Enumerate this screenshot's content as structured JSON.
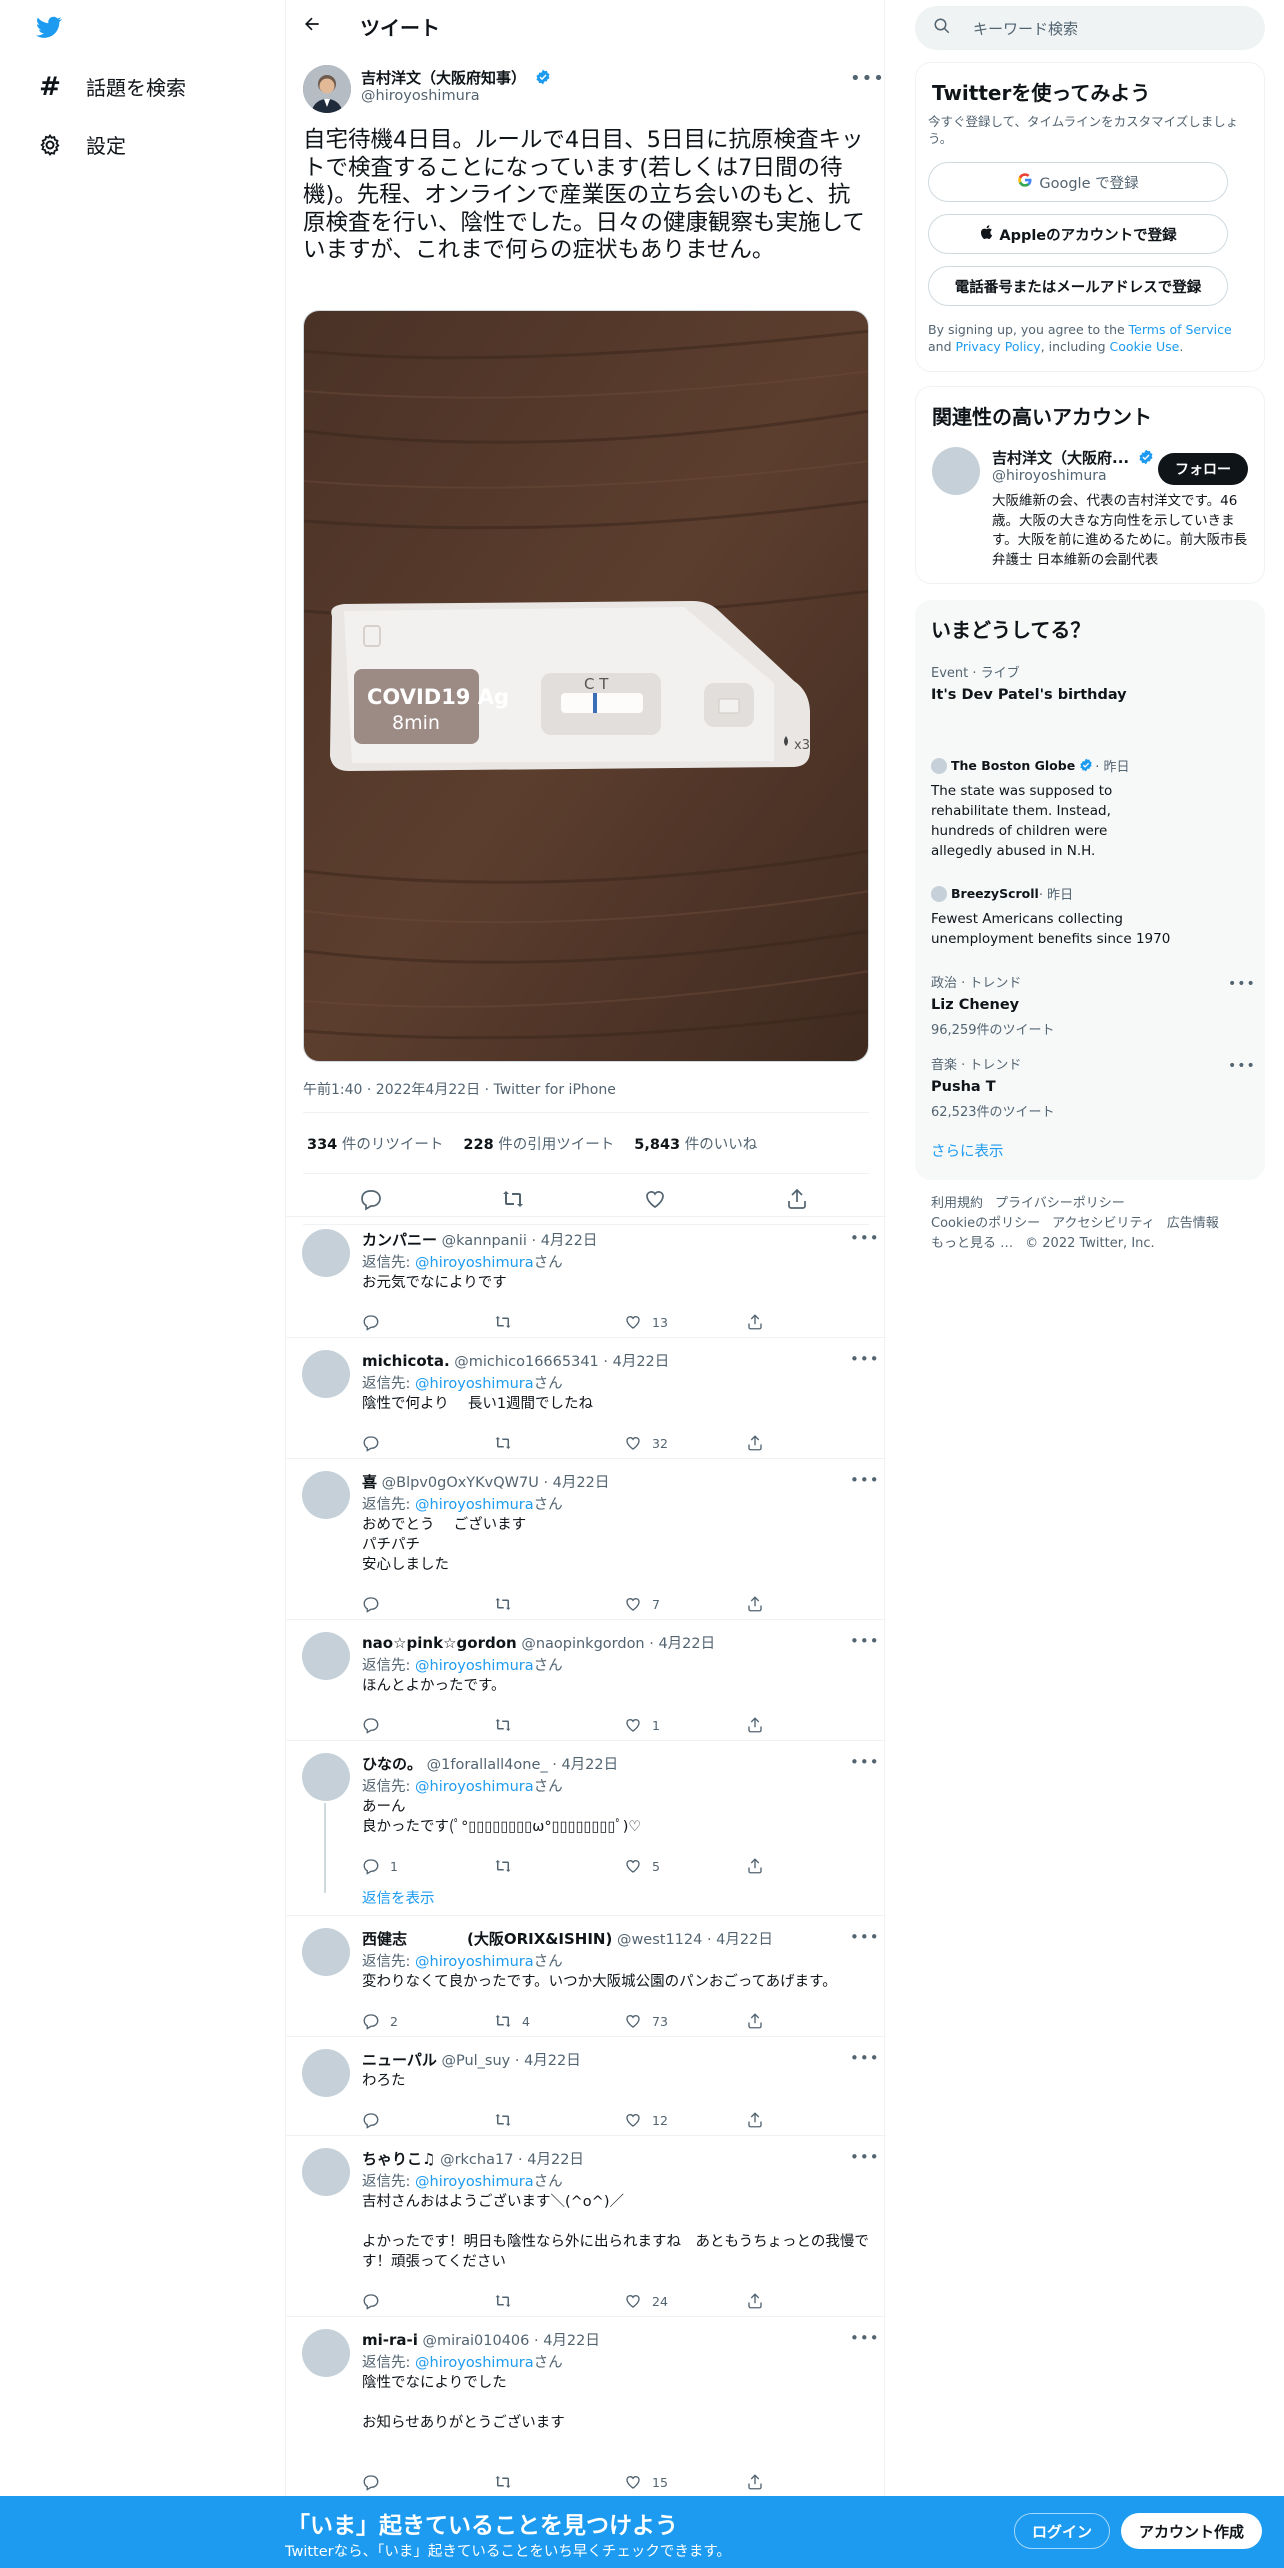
{
  "nav": {
    "logo": "twitter-bird",
    "items": [
      {
        "icon": "hashtag-icon",
        "label": "話題を検索"
      },
      {
        "icon": "gear-icon",
        "label": "設定"
      }
    ]
  },
  "header": {
    "title": "ツイート"
  },
  "tweet": {
    "author_name": "吉村洋文（大阪府知事）",
    "handle": "@hiroyoshimura",
    "text": "自宅待機4日目。ルールで4日目、5日目に抗原検査キットで検査することになっています(若しくは7日間の待機)。先程、オンラインで産業医の立ち会いのもと、抗原検査を行い、陰性でした。日々の健康観察も実施していますが、これまで何らの症状もありません。",
    "image": {
      "kit_brand": "COVID19 Ag",
      "kit_time": "8min",
      "ct": "C T",
      "drops": "x3"
    },
    "meta": "午前1:40 · 2022年4月22日 · Twitter for iPhone",
    "retweets": "334",
    "retweets_label": "件のリツイート",
    "quotes": "228",
    "quotes_label": "件の引用ツイート",
    "likes": "5,843",
    "likes_label": "件のいいね"
  },
  "replies": [
    {
      "name": "カンパニー",
      "handle": "@kannpanii · 4月22日",
      "reply_to_prefix": "返信先: ",
      "reply_to": "@hiroyoshimura",
      "reply_to_suffix": "さん",
      "text": "お元気でなによりです",
      "replies": "",
      "retweets": "",
      "likes": "13"
    },
    {
      "name": "michicota.",
      "handle": "@michico16665341 · 4月22日",
      "reply_to_prefix": "返信先: ",
      "reply_to": "@hiroyoshimura",
      "reply_to_suffix": "さん",
      "text": "陰性で何より　 長い1週間でしたね",
      "replies": "",
      "retweets": "",
      "likes": "32"
    },
    {
      "name": "喜",
      "handle": "@Blpv0gOxYKvQW7U · 4月22日",
      "reply_to_prefix": "返信先: ",
      "reply_to": "@hiroyoshimura",
      "reply_to_suffix": "さん",
      "text": "おめでとう　 ございます\nパチパチ\n安心しました",
      "replies": "",
      "retweets": "",
      "likes": "7"
    },
    {
      "name": "nao☆pink☆gordon",
      "handle": "@naopinkgordon · 4月22日",
      "reply_to_prefix": "返信先: ",
      "reply_to": "@hiroyoshimura",
      "reply_to_suffix": "さん",
      "text": "ほんとよかったです。",
      "replies": "",
      "retweets": "",
      "likes": "1"
    },
    {
      "name": "ひなの。",
      "handle": "@1forallall4one_ · 4月22日",
      "reply_to_prefix": "返信先: ",
      "reply_to": "@hiroyoshimura",
      "reply_to_suffix": "さん",
      "text": "あーん\n良かったです(ﾟ°▯▯▯▯▯▯▯▯ω°▯▯▯▯▯▯▯▯ﾟ)♡",
      "replies": "1",
      "retweets": "",
      "likes": "5",
      "show_replies": "返信を表示"
    },
    {
      "name": "西健志　　　　(大阪ORIX&ISHIN)",
      "handle": "@west1124 · 4月22日",
      "reply_to_prefix": "返信先: ",
      "reply_to": "@hiroyoshimura",
      "reply_to_suffix": "さん",
      "text": "変わりなくて良かったです。いつか大阪城公園のパンおごってあげます。",
      "replies": "2",
      "retweets": "4",
      "likes": "73"
    },
    {
      "name": "ニューパル",
      "handle": "@Pul_suy · 4月22日",
      "text": "わろた",
      "replies": "",
      "retweets": "",
      "likes": "12"
    },
    {
      "name": "ちゃりこ♫",
      "handle": "@rkcha17 · 4月22日",
      "reply_to_prefix": "返信先: ",
      "reply_to": "@hiroyoshimura",
      "reply_to_suffix": "さん",
      "text": "吉村さんおはようございます＼(^o^)／\n\nよかったです！明日も陰性なら外に出られますね　あともうちょっとの我慢です！頑張ってください",
      "replies": "",
      "retweets": "",
      "likes": "24"
    },
    {
      "name": "mi-ra-i",
      "handle": "@mirai010406 · 4月22日",
      "reply_to_prefix": "返信先: ",
      "reply_to": "@hiroyoshimura",
      "reply_to_suffix": "さん",
      "text": "陰性でなによりでした\n\nお知らせありがとうございます",
      "replies": "",
      "retweets": "",
      "likes": "15"
    }
  ],
  "right": {
    "search_placeholder": "キーワード検索",
    "join": {
      "title": "Twitterを使ってみよう",
      "subtitle": "今すぐ登録して、タイムラインをカスタマイズしましょう。",
      "google": "Google で登録",
      "apple": "Appleのアカウントで登録",
      "phone": "電話番号またはメールアドレスで登録",
      "terms_pre": "By signing up, you agree to the ",
      "terms_tos": "Terms of Service",
      "terms_and": " and ",
      "terms_pp": "Privacy Policy",
      "terms_inc": ", including ",
      "terms_cookie": "Cookie Use",
      "terms_end": "."
    },
    "related": {
      "title": "関連性の高いアカウント",
      "name": "吉村洋文（大阪府...",
      "handle": "@hiroyoshimura",
      "follow": "フォロー",
      "bio": "大阪維新の会、代表の吉村洋文です。46歳。大阪の大きな方向性を示していきます。大阪を前に進めるために。前大阪市長 弁護士 日本維新の会副代表"
    },
    "trends": {
      "title": "いまどうしてる？",
      "items": [
        {
          "cat": "Event · ライブ",
          "title": "It's Dev Patel's birthday",
          "count": ""
        },
        {
          "source": "The Boston Globe",
          "when": " · 昨日",
          "title": "The state was supposed to rehabilitate them. Instead, hundreds of children were allegedly abused in N.H."
        },
        {
          "source": "BreezyScroll",
          "when": " · 昨日",
          "title": "Fewest Americans collecting unemployment benefits since 1970"
        },
        {
          "cat": "政治 · トレンド",
          "title": "Liz Cheney",
          "count": "96,259件のツイート"
        },
        {
          "cat": "音楽 · トレンド",
          "title": "Pusha T",
          "count": "62,523件のツイート"
        }
      ],
      "more": "さらに表示"
    },
    "footer": {
      "links1": [
        "利用規約",
        "プライバシーポリシー"
      ],
      "links2": [
        "Cookieのポリシー",
        "アクセシビリティ",
        "広告情報"
      ],
      "links3": [
        "もっと見る …",
        "© 2022 Twitter, Inc."
      ]
    }
  },
  "banner": {
    "title": "「いま」起きていることを見つけよう",
    "subtitle": "Twitterなら、「いま」起きていることをいち早くチェックできます。",
    "login": "ログイン",
    "signup": "アカウント作成"
  },
  "colors": {
    "accent": "#1d9bf0",
    "text": "#0f1419",
    "muted": "#536471",
    "border": "#eff3f4"
  }
}
